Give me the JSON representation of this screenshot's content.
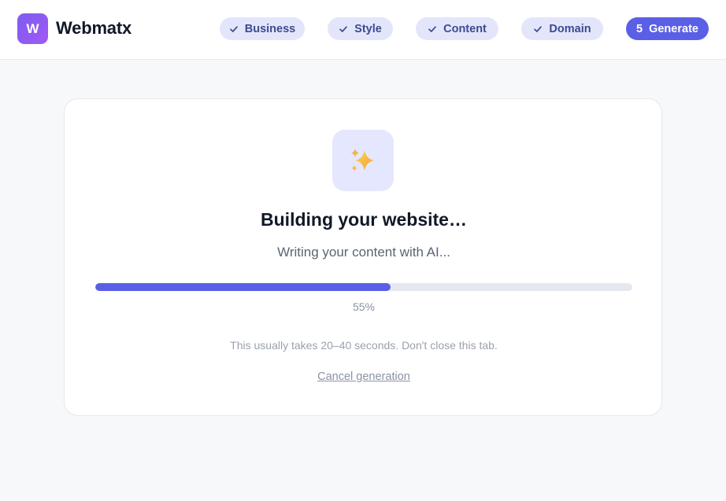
{
  "header": {
    "logo_letter": "W",
    "brand": "Webmatx",
    "steps": [
      {
        "label": "Business",
        "state": "done",
        "icon": "check-icon"
      },
      {
        "label": "Style",
        "state": "done",
        "icon": "check-icon"
      },
      {
        "label": "Content",
        "state": "done",
        "icon": "check-icon"
      },
      {
        "label": "Domain",
        "state": "done",
        "icon": "check-icon"
      },
      {
        "number": "5",
        "label": "Generate",
        "state": "active"
      }
    ]
  },
  "main": {
    "icon": "sparkles-icon",
    "title": "Building your website…",
    "subtitle": "Writing your content with AI...",
    "progress": 55,
    "progress_label": "55%",
    "note": "This usually takes 20–40 seconds. Don't close this tab.",
    "cancel_label": "Cancel generation"
  },
  "colors": {
    "accent": "#5b5fe6",
    "step_bg": "#e3e6fb",
    "step_text": "#3e4a8e",
    "page_bg": "#f7f8fa"
  }
}
